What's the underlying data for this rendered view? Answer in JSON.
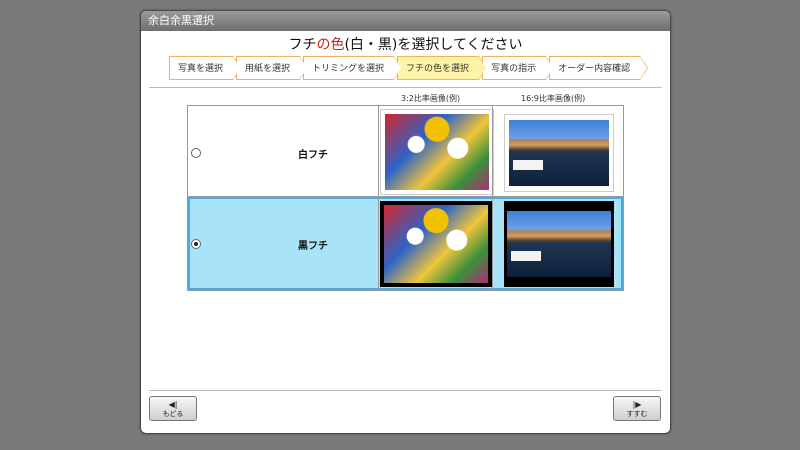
{
  "window": {
    "title": "余白余黒選択"
  },
  "heading": {
    "prefix": "フチ",
    "highlight": "の色",
    "suffix": "(白・黒)を選択してください"
  },
  "steps": [
    {
      "label": "写真を選択",
      "active": false
    },
    {
      "label": "用紙を選択",
      "active": false
    },
    {
      "label": "トリミングを選択",
      "active": false
    },
    {
      "label": "フチの色を選択",
      "active": true
    },
    {
      "label": "写真の指示",
      "active": false
    },
    {
      "label": "オーダー内容確認",
      "active": false
    }
  ],
  "columns": {
    "ratio_3_2": "3:2比率画像(例)",
    "ratio_16_9": "16:9比率画像(例)"
  },
  "options": [
    {
      "label": "白フチ",
      "selected": false
    },
    {
      "label": "黒フチ",
      "selected": true
    }
  ],
  "icons": {
    "back": "back-arrow-icon",
    "next": "next-arrow-icon"
  },
  "buttons": {
    "back_label": "もどる",
    "next_label": "すすむ"
  },
  "colors": {
    "accent_border": "#49a9e6",
    "selected_bg": "#a9e3f7",
    "step_active": "#fff3a8",
    "step_border": "#f0b060"
  }
}
